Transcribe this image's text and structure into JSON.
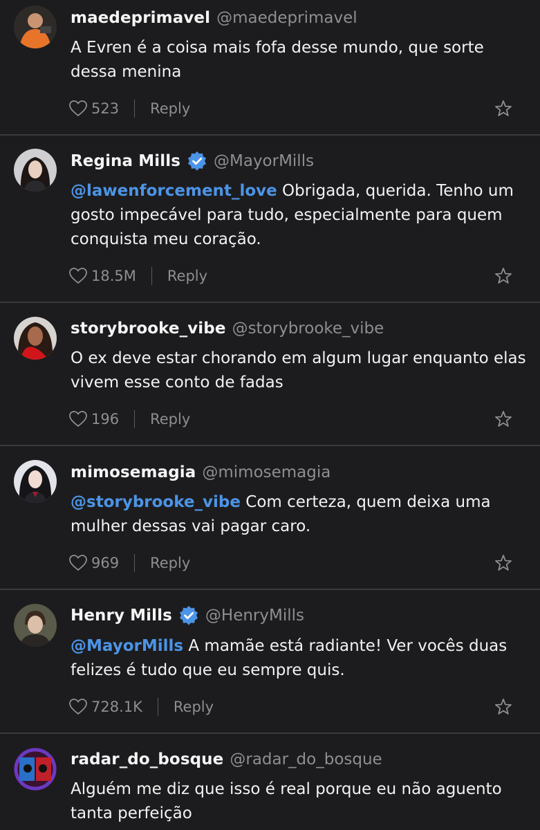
{
  "comments": [
    {
      "name": "maedeprimavel",
      "handle": "@maedeprimavel",
      "verified": false,
      "mention": "",
      "text": "A Evren é a coisa mais fofa desse mundo, que sorte dessa menina",
      "likes": "523",
      "reply": "Reply"
    },
    {
      "name": "Regina Mills",
      "handle": "@MayorMills",
      "verified": true,
      "mention": "@lawenforcement_love",
      "text": "Obrigada, querida. Tenho um gosto impecável para tudo, especialmente para quem conquista meu coração.",
      "likes": "18.5M",
      "reply": "Reply"
    },
    {
      "name": "storybrooke_vibe",
      "handle": "@storybrooke_vibe",
      "verified": false,
      "mention": "",
      "text": "O ex deve estar chorando em algum lugar enquanto elas vivem esse conto de fadas",
      "likes": "196",
      "reply": "Reply"
    },
    {
      "name": "mimosemagia",
      "handle": "@mimosemagia",
      "verified": false,
      "mention": "@storybrooke_vibe",
      "text": "Com certeza, quem deixa uma mulher dessas vai pagar caro.",
      "likes": "969",
      "reply": "Reply"
    },
    {
      "name": "Henry Mills",
      "handle": "@HenryMills",
      "verified": true,
      "mention": "@MayorMills",
      "text": "A mamãe está radiante! Ver vocês duas felizes é tudo que eu sempre quis.",
      "likes": "728.1K",
      "reply": "Reply"
    },
    {
      "name": "radar_do_bosque",
      "handle": "@radar_do_bosque",
      "verified": false,
      "mention": "",
      "text": "Alguém me diz que isso é real porque eu não aguento tanta perfeição",
      "likes": "",
      "reply": ""
    }
  ],
  "icons": {
    "like": "heart-outline-icon",
    "favorite": "star-outline-icon",
    "verified": "verified-badge-icon"
  },
  "colors": {
    "background": "#1c1c1e",
    "mention": "#4c94e6",
    "verified": "#4c94e6",
    "muted": "#8e8e93"
  }
}
